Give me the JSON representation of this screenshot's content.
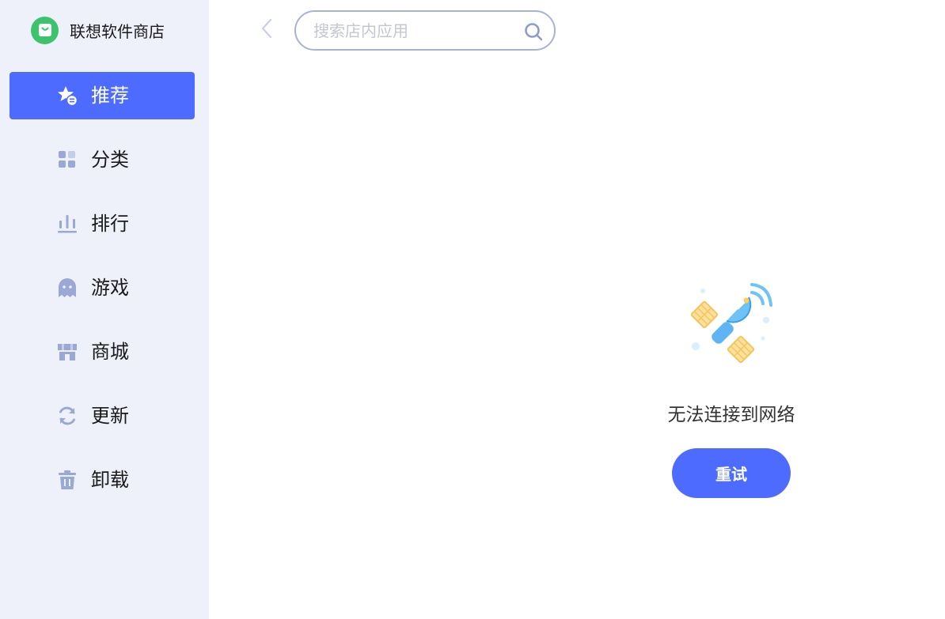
{
  "app": {
    "name": "联想软件商店",
    "brand_color": "#3cc36b",
    "accent_color": "#4d6bfe"
  },
  "sidebar": {
    "items": [
      {
        "label": "推荐",
        "icon": "star-badge-icon",
        "active": true
      },
      {
        "label": "分类",
        "icon": "grid-icon",
        "active": false
      },
      {
        "label": "排行",
        "icon": "bar-chart-icon",
        "active": false
      },
      {
        "label": "游戏",
        "icon": "ghost-icon",
        "active": false
      },
      {
        "label": "商城",
        "icon": "store-icon",
        "active": false
      },
      {
        "label": "更新",
        "icon": "refresh-icon",
        "active": false
      },
      {
        "label": "卸载",
        "icon": "trash-icon",
        "active": false
      }
    ]
  },
  "topbar": {
    "back_icon": "chevron-left-icon",
    "search": {
      "placeholder": "搜索店内应用",
      "value": "",
      "icon": "search-icon"
    }
  },
  "main": {
    "illustration": "satellite-icon",
    "error_message": "无法连接到网络",
    "retry_label": "重试"
  }
}
